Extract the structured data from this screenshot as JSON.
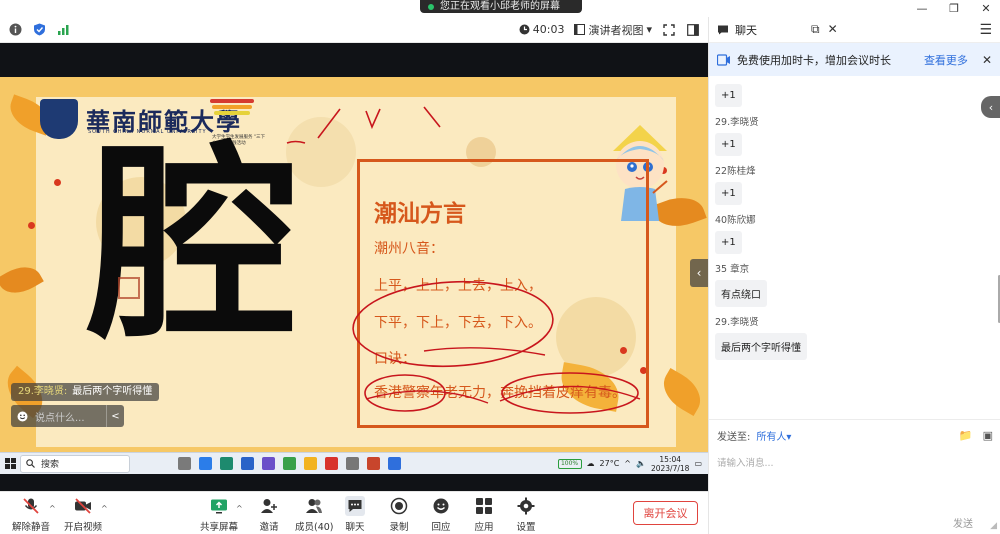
{
  "window": {
    "share_banner": "您正在观看小邱老师的屏幕",
    "minimize": "—",
    "restore": "❐",
    "close": "✕"
  },
  "meeting_toolbar": {
    "timer": "40:03",
    "view_mode": "演讲者视图",
    "view_caret": "▾"
  },
  "slide": {
    "school_name": "華南師範大學",
    "school_en": "SOUTH CHINA NORMAL UNIVERSITY",
    "logo_sub": "大学生学生发展服务 \"三下乡\"社会实践活动",
    "big_char": "腔",
    "title": "潮汕方言",
    "subhead": "潮州八音：",
    "tones_line1": "上平，上上，上去，上入，",
    "tones_line2": "下平，下上，下去，下入。",
    "rhyme_label": "口诀：",
    "rhyme_text": "香港警察年老无力，奔挽挡着皮痒有毒。",
    "stripe_colors": [
      "#d63a2f",
      "#f2a12a",
      "#e6d23a",
      "#3a9d4e",
      "#2f6fdc"
    ]
  },
  "slide_chat": {
    "sender": "29.李晓贤:",
    "text": "最后两个字听得懂",
    "input_placeholder": "说点什么...",
    "chevron": "<"
  },
  "taskbar": {
    "search": "搜索",
    "battery": "100%",
    "weather": "27°C",
    "time": "15:04",
    "date": "2023/7/18"
  },
  "bottom_bar": {
    "unmute": "解除静音",
    "start_video": "开启视频",
    "share_screen": "共享屏幕",
    "invite": "邀请",
    "members": "成员(40)",
    "chat": "聊天",
    "record": "录制",
    "reactions": "回应",
    "apps": "应用",
    "settings": "设置",
    "leave": "离开会议"
  },
  "chat_panel": {
    "title": "聊天",
    "promo_text": "免费使用加时卡，增加会议时长",
    "promo_link": "查看更多",
    "messages": [
      {
        "name": "",
        "text": "+1"
      },
      {
        "name": "29.李晓贤",
        "text": "+1"
      },
      {
        "name": "22陈桂烽",
        "text": "+1"
      },
      {
        "name": "40陈欣娜",
        "text": "+1"
      },
      {
        "name": "35  章京",
        "text": "有点绕口"
      },
      {
        "name": "29.李晓贤",
        "text": "最后两个字听得懂"
      }
    ],
    "send_to_label": "发送至:",
    "send_to_value": "所有人",
    "input_placeholder": "请输入消息...",
    "send_button": "发送"
  },
  "colors": {
    "accent": "#2f6fdc",
    "danger": "#e0443e",
    "slide_orange": "#d6581c",
    "ink_red": "#c8161d"
  }
}
